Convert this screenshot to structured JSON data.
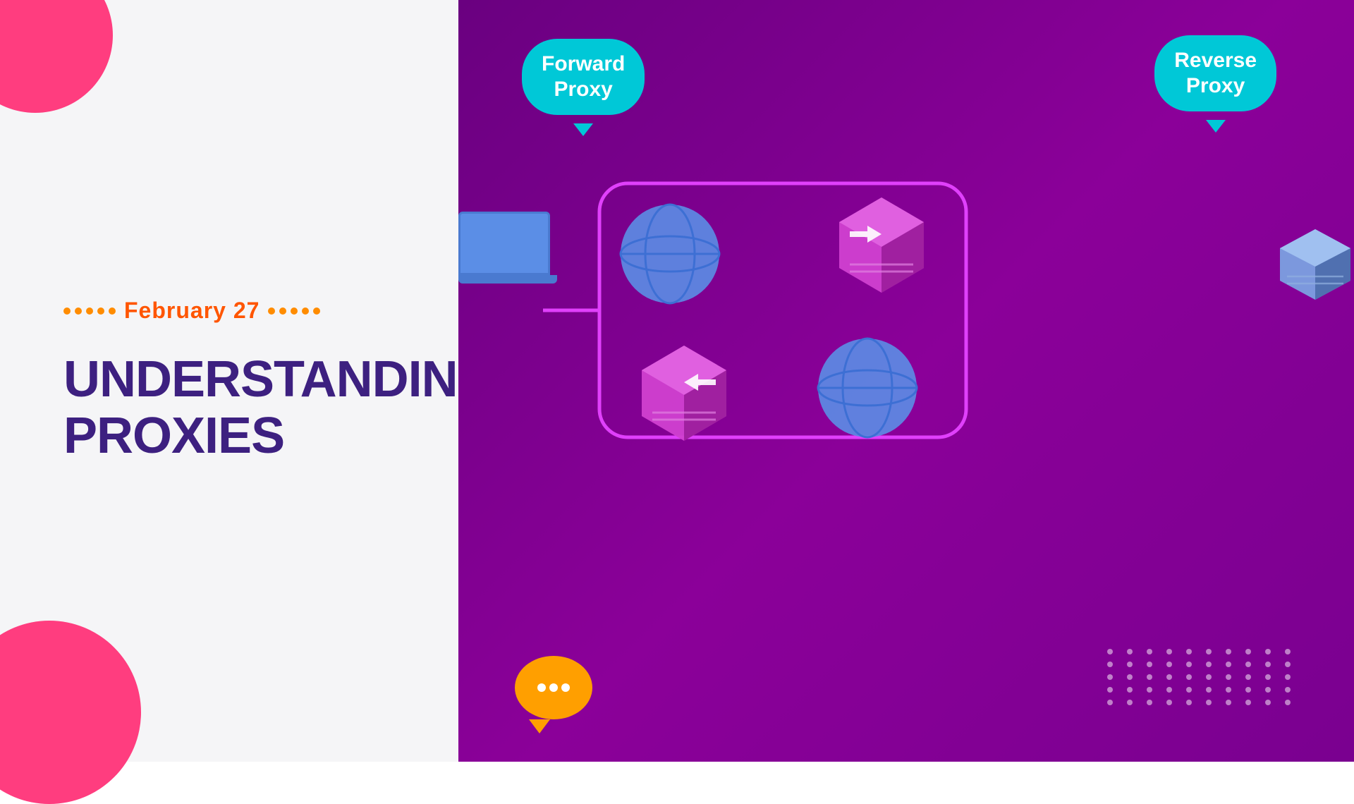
{
  "left": {
    "date": "February 27",
    "title_line1": "UNDERSTANDING",
    "title_line2": "PROXIES",
    "dots_count": 5
  },
  "right": {
    "bubble_forward": "Forward\nProxy",
    "bubble_reverse": "Reverse\nProxy",
    "accent_color": "#7b0099",
    "bubble_color": "#00c8d7"
  },
  "colors": {
    "pink": "#ff3d7f",
    "orange": "#ff8c00",
    "purple": "#3d2080",
    "bg_right": "#7b0099",
    "cyan": "#00c8d7"
  }
}
